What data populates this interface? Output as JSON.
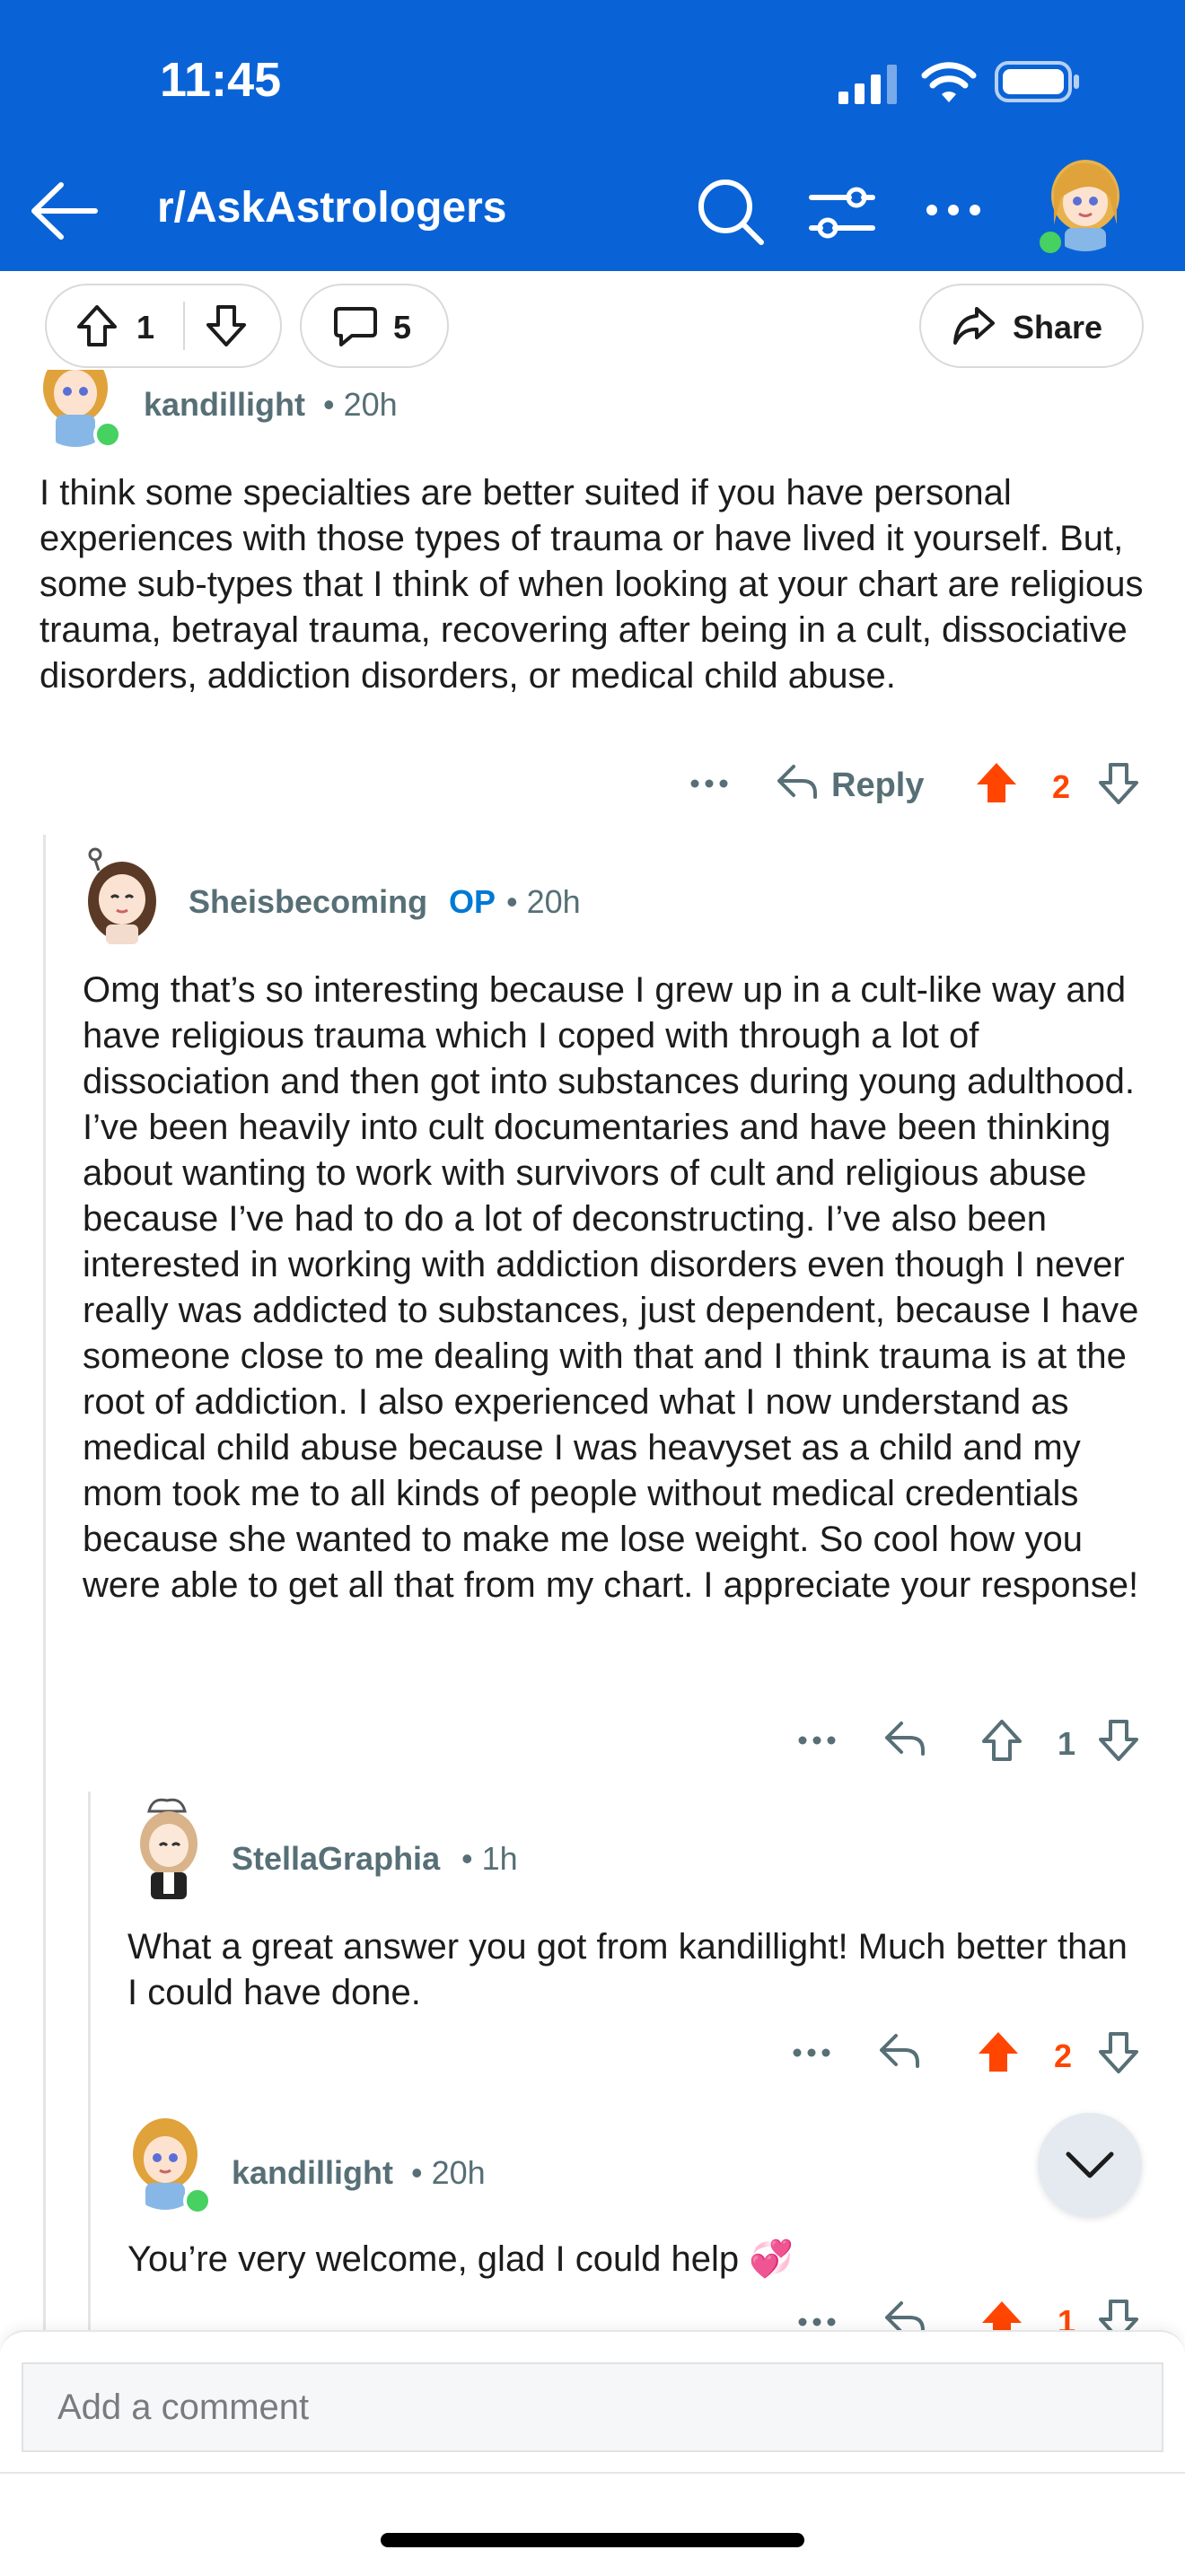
{
  "status_bar": {
    "time": "11:45"
  },
  "header": {
    "subreddit": "r/AskAstrologers"
  },
  "post_actions": {
    "upvotes": "1",
    "comments": "5",
    "share_label": "Share"
  },
  "comments": [
    {
      "author": "kandillight",
      "time": "• 20h",
      "body": "I think some specialties are better suited if you have personal experiences with those types of trauma or have lived it yourself. But, some sub-types that I think of when looking at your chart are religious trauma, betrayal trauma, recovering after being in a cult, dissociative disorders, addiction disorders, or medical child abuse.",
      "reply_label": "Reply",
      "votes": "2"
    },
    {
      "author": "Sheisbecoming",
      "op_label": "OP",
      "time": "• 20h",
      "body": "Omg that’s so interesting because I grew up in a cult-like way and have religious trauma which I coped with through a lot of dissociation and then got into substances during young adulthood. I’ve been heavily into cult documentaries and have been thinking about wanting to work with survivors of cult and religious abuse because I’ve had to do a lot of deconstructing. I’ve also been interested in working with addiction disorders even though I never really was addicted to substances, just dependent, because I have someone close to me dealing with that and I think trauma is at the root of addiction. I also experienced what I now understand as medical child abuse because I was heavyset as a child and my mom took me to all kinds of people without medical credentials because she wanted to make me lose weight. So cool how you were able to get all that from my chart. I appreciate your response!",
      "votes": "1"
    },
    {
      "author": "StellaGraphia",
      "time": "• 1h",
      "body": "What a great answer you got from kandillight!  Much better than I could have done.",
      "votes": "2"
    },
    {
      "author": "kandillight",
      "time": "• 20h",
      "body": "You’re very welcome, glad I could help 💞",
      "votes": "1"
    }
  ],
  "composer": {
    "placeholder": "Add a comment"
  },
  "colors": {
    "brand_blue": "#0a63d6",
    "upvote_orange": "#ff4500",
    "meta_gray": "#576f76"
  }
}
